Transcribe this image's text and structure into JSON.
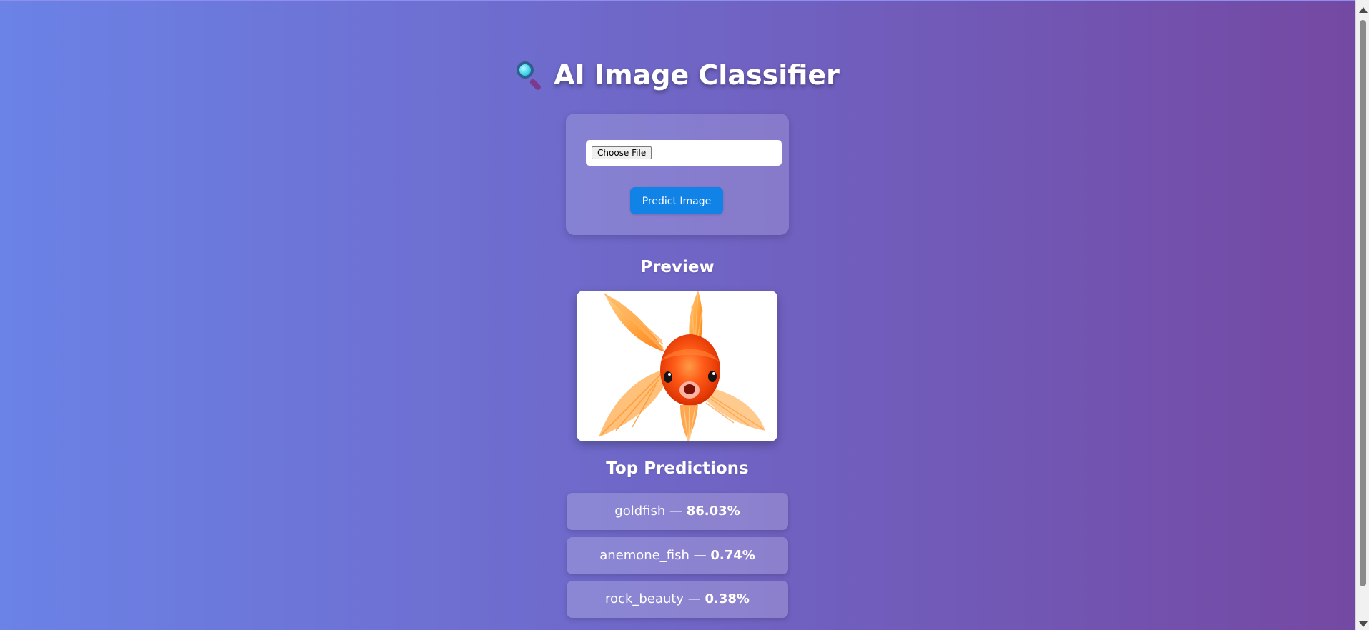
{
  "app": {
    "title": "AI Image Classifier",
    "title_icon": "magnifying-glass-icon"
  },
  "upload": {
    "file_button_label": "Choose File",
    "predict_button_label": "Predict Image",
    "button_color": "#1182e6"
  },
  "preview": {
    "heading": "Preview",
    "image_subject": "goldfish"
  },
  "predictions": {
    "heading": "Top Predictions",
    "items": [
      {
        "label": "goldfish",
        "value": "86.03%"
      },
      {
        "label": "anemone_fish",
        "value": "0.74%"
      },
      {
        "label": "rock_beauty",
        "value": "0.38%"
      }
    ]
  },
  "colors": {
    "background_start": "#6b82e6",
    "background_end": "#7448a2",
    "text": "#ffffff"
  }
}
